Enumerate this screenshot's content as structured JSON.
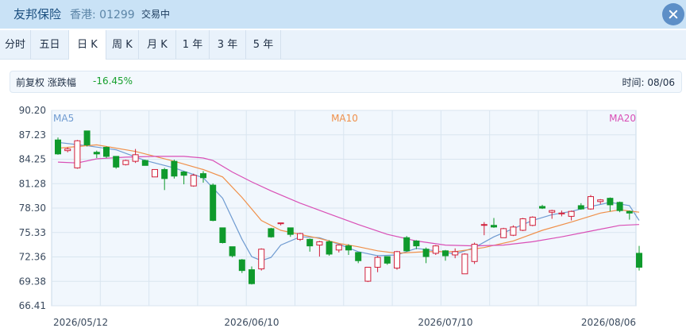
{
  "header": {
    "stock_name": "友邦保险",
    "market_code": "香港: 01299",
    "status": "交易中"
  },
  "tabs": [
    {
      "label": "分时"
    },
    {
      "label": "五日"
    },
    {
      "label": "日 K",
      "active": true
    },
    {
      "label": "周 K"
    },
    {
      "label": "月 K"
    },
    {
      "label": "1 年"
    },
    {
      "label": "3 年"
    },
    {
      "label": "5 年"
    }
  ],
  "info": {
    "adjust_label": "前复权 涨跌幅",
    "change": "-16.45%",
    "time": "时间: 08/06"
  },
  "colors": {
    "up": "#d11f3a",
    "down": "#0f9a2c",
    "ma5": "#6f9bd1",
    "ma10": "#f0904a",
    "ma20": "#d94fb6",
    "grid": "#d9e5f0",
    "plot_bg": "#f1f7fd"
  },
  "chart_data": {
    "type": "candlestick",
    "ylim": [
      66.41,
      90.2
    ],
    "y_ticks": [
      "90.20",
      "87.23",
      "84.25",
      "81.28",
      "78.30",
      "75.33",
      "72.36",
      "69.38",
      "66.41"
    ],
    "x_tick_labels": [
      "2026/05/12",
      "2026/06/10",
      "2026/07/10",
      "2026/08/06"
    ],
    "legend": [
      "MA5",
      "MA10",
      "MA20"
    ],
    "candles": [
      [
        86.6,
        84.9,
        86.9,
        84.8
      ],
      [
        85.3,
        85.5,
        85.7,
        85.1
      ],
      [
        83.2,
        86.5,
        86.6,
        83.1
      ],
      [
        87.7,
        86.0,
        87.7,
        85.8
      ],
      [
        85.1,
        84.9,
        85.3,
        84.4
      ],
      [
        85.7,
        84.6,
        85.8,
        84.4
      ],
      [
        84.6,
        83.3,
        84.6,
        83.1
      ],
      [
        83.6,
        84.1,
        84.2,
        83.5
      ],
      [
        84.0,
        84.8,
        85.5,
        83.8
      ],
      [
        84.1,
        83.5,
        84.2,
        83.5
      ],
      [
        82.1,
        83.0,
        83.0,
        82.1
      ],
      [
        83.0,
        81.9,
        83.2,
        80.5
      ],
      [
        84.0,
        82.2,
        84.2,
        81.9
      ],
      [
        82.7,
        82.3,
        82.8,
        81.2
      ],
      [
        81.0,
        82.3,
        82.5,
        80.9
      ],
      [
        82.5,
        82.0,
        82.8,
        81.4
      ],
      [
        81.1,
        76.8,
        81.3,
        76.7
      ],
      [
        75.9,
        74.1,
        75.9,
        74.0
      ],
      [
        73.6,
        72.5,
        73.6,
        72.3
      ],
      [
        72.0,
        70.7,
        72.1,
        70.4
      ],
      [
        70.8,
        69.1,
        71.2,
        69.0
      ],
      [
        70.9,
        73.3,
        73.4,
        70.7
      ],
      [
        75.8,
        74.8,
        75.9,
        74.7
      ],
      [
        76.4,
        76.5,
        76.5,
        76.2
      ],
      [
        75.9,
        75.1,
        75.9,
        74.8
      ],
      [
        74.5,
        75.2,
        75.3,
        74.3
      ],
      [
        74.5,
        73.7,
        74.6,
        73.0
      ],
      [
        73.8,
        74.2,
        74.3,
        72.4
      ],
      [
        74.2,
        72.7,
        74.4,
        72.5
      ],
      [
        73.2,
        73.8,
        73.8,
        72.9
      ],
      [
        73.7,
        73.2,
        73.9,
        72.6
      ],
      [
        72.9,
        71.9,
        72.9,
        71.6
      ],
      [
        69.4,
        71.1,
        71.1,
        69.3
      ],
      [
        71.1,
        72.3,
        72.5,
        70.5
      ],
      [
        72.4,
        71.6,
        72.4,
        71.4
      ],
      [
        71.0,
        73.0,
        73.1,
        70.8
      ],
      [
        74.7,
        73.1,
        74.9,
        73.0
      ],
      [
        74.3,
        73.7,
        74.4,
        73.3
      ],
      [
        73.3,
        72.4,
        73.5,
        71.6
      ],
      [
        72.8,
        73.7,
        73.8,
        72.6
      ],
      [
        73.1,
        72.5,
        73.2,
        71.9
      ],
      [
        72.6,
        73.0,
        73.4,
        72.2
      ],
      [
        70.3,
        72.7,
        72.8,
        70.3
      ],
      [
        71.8,
        73.9,
        74.1,
        71.5
      ],
      [
        76.3,
        76.3,
        76.6,
        75.0
      ],
      [
        76.2,
        76.0,
        77.1,
        75.9
      ],
      [
        74.7,
        75.8,
        75.9,
        74.7
      ],
      [
        75.0,
        76.0,
        76.2,
        74.9
      ],
      [
        75.6,
        77.0,
        77.1,
        75.5
      ],
      [
        76.2,
        77.2,
        77.3,
        76.1
      ],
      [
        78.5,
        78.3,
        78.7,
        78.2
      ],
      [
        77.8,
        78.0,
        78.1,
        77.0
      ],
      [
        77.6,
        77.7,
        78.0,
        77.3
      ],
      [
        77.3,
        77.9,
        78.0,
        76.8
      ],
      [
        78.6,
        78.2,
        78.9,
        78.1
      ],
      [
        78.2,
        79.7,
        79.9,
        78.1
      ],
      [
        79.1,
        79.3,
        79.4,
        78.8
      ],
      [
        79.5,
        78.7,
        79.6,
        77.9
      ],
      [
        79.0,
        78.0,
        79.1,
        77.8
      ],
      [
        77.9,
        77.7,
        78.0,
        76.9
      ],
      [
        72.8,
        71.1,
        73.7,
        70.7
      ]
    ],
    "ma5": [
      [
        0,
        86.3
      ],
      [
        3,
        85.9
      ],
      [
        6,
        85.4
      ],
      [
        9,
        84.1
      ],
      [
        12,
        83.2
      ],
      [
        15,
        82.0
      ],
      [
        17,
        79.5
      ],
      [
        19,
        74.5
      ],
      [
        20,
        72.4
      ],
      [
        21,
        71.9
      ],
      [
        22,
        72.3
      ],
      [
        23,
        73.8
      ],
      [
        25,
        74.8
      ],
      [
        27,
        74.7
      ],
      [
        29,
        73.9
      ],
      [
        31,
        73.0
      ],
      [
        33,
        72.5
      ],
      [
        35,
        72.6
      ],
      [
        37,
        73.4
      ],
      [
        39,
        73.1
      ],
      [
        41,
        72.7
      ],
      [
        43,
        73.5
      ],
      [
        45,
        74.8
      ],
      [
        47,
        75.8
      ],
      [
        49,
        76.8
      ],
      [
        51,
        77.5
      ],
      [
        53,
        77.9
      ],
      [
        55,
        78.5
      ],
      [
        57,
        79.0
      ],
      [
        59,
        78.6
      ],
      [
        60,
        76.8
      ]
    ],
    "ma10": [
      [
        0,
        85.6
      ],
      [
        4,
        86.0
      ],
      [
        8,
        85.2
      ],
      [
        12,
        84.0
      ],
      [
        15,
        83.0
      ],
      [
        17,
        82.1
      ],
      [
        19,
        79.6
      ],
      [
        21,
        76.8
      ],
      [
        23,
        75.6
      ],
      [
        25,
        75.1
      ],
      [
        27,
        74.6
      ],
      [
        29,
        74.0
      ],
      [
        31,
        73.6
      ],
      [
        33,
        73.1
      ],
      [
        35,
        72.8
      ],
      [
        38,
        73.0
      ],
      [
        41,
        73.0
      ],
      [
        44,
        73.5
      ],
      [
        47,
        74.3
      ],
      [
        50,
        75.6
      ],
      [
        53,
        76.6
      ],
      [
        56,
        77.7
      ],
      [
        58,
        78.1
      ],
      [
        60,
        77.8
      ]
    ],
    "ma20": [
      [
        0,
        83.9
      ],
      [
        2,
        83.8
      ],
      [
        4,
        84.3
      ],
      [
        7,
        84.5
      ],
      [
        10,
        84.6
      ],
      [
        13,
        84.6
      ],
      [
        15,
        84.4
      ],
      [
        16,
        84.1
      ],
      [
        18,
        82.7
      ],
      [
        20,
        81.5
      ],
      [
        22,
        80.4
      ],
      [
        25,
        78.9
      ],
      [
        28,
        77.6
      ],
      [
        31,
        76.3
      ],
      [
        34,
        75.1
      ],
      [
        37,
        74.3
      ],
      [
        40,
        73.8
      ],
      [
        43,
        73.7
      ],
      [
        46,
        73.8
      ],
      [
        49,
        74.2
      ],
      [
        52,
        74.8
      ],
      [
        55,
        75.5
      ],
      [
        58,
        76.2
      ],
      [
        60,
        76.3
      ]
    ]
  }
}
